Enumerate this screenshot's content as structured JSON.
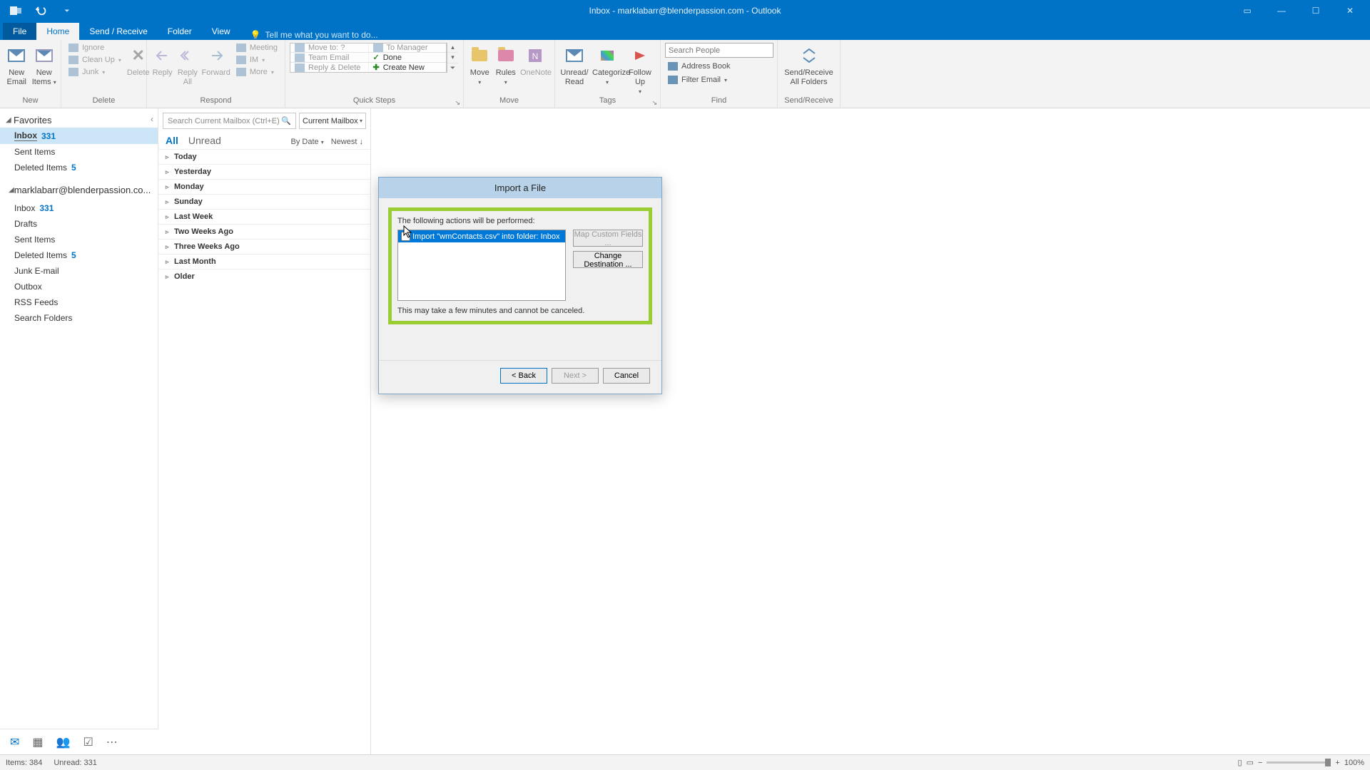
{
  "titlebar": {
    "title": "Inbox - marklabarr@blenderpassion.com - Outlook"
  },
  "tabs": {
    "file": "File",
    "home": "Home",
    "sendreceive": "Send / Receive",
    "folder": "Folder",
    "view": "View",
    "tellme": "Tell me what you want to do..."
  },
  "ribbon": {
    "new": {
      "email": "New\nEmail",
      "items": "New\nItems",
      "label": "New"
    },
    "delete": {
      "ignore": "Ignore",
      "cleanup": "Clean Up",
      "junk": "Junk",
      "delete": "Delete",
      "label": "Delete"
    },
    "respond": {
      "reply": "Reply",
      "replyall": "Reply\nAll",
      "forward": "Forward",
      "meeting": "Meeting",
      "im": "IM",
      "more": "More",
      "label": "Respond"
    },
    "quicksteps": {
      "moveto": "Move to: ?",
      "tomanager": "To Manager",
      "teamemail": "Team Email",
      "done": "Done",
      "replydelete": "Reply & Delete",
      "createnew": "Create New",
      "label": "Quick Steps"
    },
    "move": {
      "move": "Move",
      "rules": "Rules",
      "onenote": "OneNote",
      "label": "Move"
    },
    "tags": {
      "unread": "Unread/\nRead",
      "categorize": "Categorize",
      "followup": "Follow\nUp",
      "label": "Tags"
    },
    "find": {
      "search_placeholder": "Search People",
      "addressbook": "Address Book",
      "filteremail": "Filter Email",
      "label": "Find"
    },
    "sendrecv": {
      "btn": "Send/Receive\nAll Folders",
      "label": "Send/Receive"
    }
  },
  "folder": {
    "favorites": "Favorites",
    "items": [
      {
        "name": "Inbox",
        "count": "331",
        "selected": true
      },
      {
        "name": "Sent Items"
      },
      {
        "name": "Deleted Items",
        "count": "5"
      }
    ],
    "account": "marklabarr@blenderpassion.co...",
    "acctitems": [
      {
        "name": "Inbox",
        "count": "331"
      },
      {
        "name": "Drafts"
      },
      {
        "name": "Sent Items"
      },
      {
        "name": "Deleted Items",
        "count": "5"
      },
      {
        "name": "Junk E-mail"
      },
      {
        "name": "Outbox"
      },
      {
        "name": "RSS Feeds"
      },
      {
        "name": "Search Folders"
      }
    ]
  },
  "msglist": {
    "search_placeholder": "Search Current Mailbox (Ctrl+E)",
    "scope": "Current Mailbox",
    "all": "All",
    "unread": "Unread",
    "bydate": "By Date",
    "newest": "Newest",
    "groups": [
      "Today",
      "Yesterday",
      "Monday",
      "Sunday",
      "Last Week",
      "Two Weeks Ago",
      "Three Weeks Ago",
      "Last Month",
      "Older"
    ]
  },
  "dialog": {
    "title": "Import a File",
    "instructions": "The following actions will be performed:",
    "action": "Import \"wmContacts.csv\" into folder: Inbox",
    "map": "Map Custom Fields ...",
    "changedest": "Change Destination ...",
    "note": "This may take a few minutes and cannot be canceled.",
    "back": "< Back",
    "next": "Next >",
    "cancel": "Cancel"
  },
  "status": {
    "items": "Items: 384",
    "unread": "Unread: 331",
    "zoom": "100%"
  }
}
